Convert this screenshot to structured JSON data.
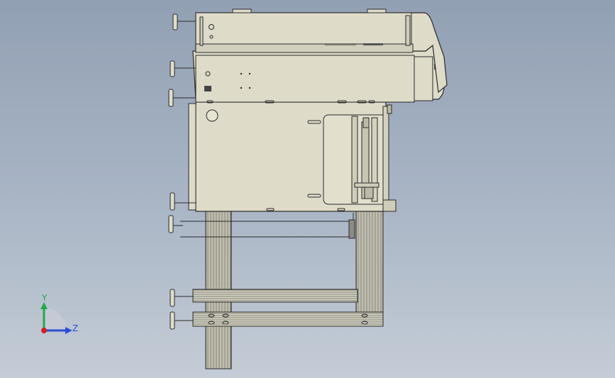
{
  "viewport": {
    "background_top": "#92a0b4",
    "background_bottom": "#c4ccd6"
  },
  "triad": {
    "y_label": "Y",
    "z_label": "Z",
    "colors": {
      "y": "#22a84a",
      "z": "#2a4fd6",
      "x": "#d02020"
    }
  },
  "model": {
    "fill": "#dedbc9",
    "stroke": "#2a2a2a"
  }
}
